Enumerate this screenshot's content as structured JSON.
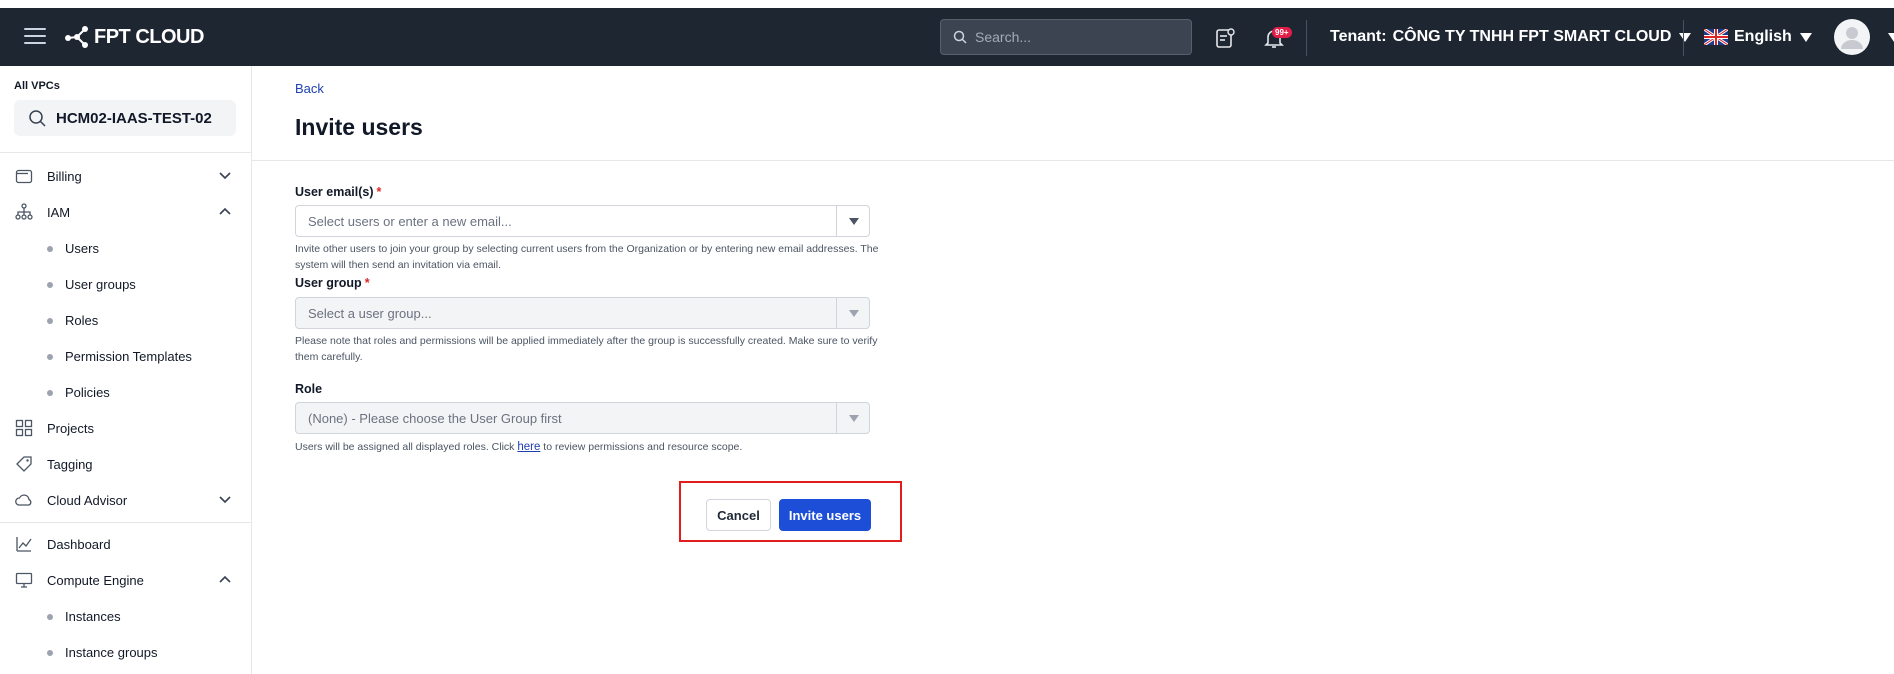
{
  "topbar": {
    "logo_text": "FPT CLOUD",
    "search_placeholder": "Search...",
    "notification_badge": "99+",
    "tenant_label": "Tenant:",
    "tenant_name": "CÔNG TY TNHH FPT SMART CLOUD",
    "language": "English",
    "language_flag": "uk-flag-icon"
  },
  "sidebar": {
    "vpc_label": "All VPCs",
    "vpc_value": "HCM02-IAAS-TEST-02",
    "items": [
      {
        "label": "Billing",
        "icon": "wallet-icon",
        "expanded": false
      },
      {
        "label": "IAM",
        "icon": "hierarchy-icon",
        "expanded": true
      },
      {
        "label": "Users"
      },
      {
        "label": "User groups"
      },
      {
        "label": "Roles"
      },
      {
        "label": "Permission Templates"
      },
      {
        "label": "Policies"
      },
      {
        "label": "Projects",
        "icon": "grid-icon"
      },
      {
        "label": "Tagging",
        "icon": "tag-icon"
      },
      {
        "label": "Cloud Advisor",
        "icon": "cloud-icon",
        "expanded": false
      },
      {
        "label": "Dashboard",
        "icon": "chart-icon"
      },
      {
        "label": "Compute Engine",
        "icon": "monitor-icon",
        "expanded": true
      },
      {
        "label": "Instances"
      },
      {
        "label": "Instance groups"
      }
    ]
  },
  "main": {
    "back_label": "Back",
    "title": "Invite users",
    "email_label": "User email(s)",
    "email_placeholder": "Select users or enter a new email...",
    "email_help": "Invite other users to join your group by selecting current users from the Organization or by entering new email addresses. The system will then send an invitation via email.",
    "group_label": "User group",
    "group_placeholder": "Select a user group...",
    "group_help": "Please note that roles and permissions will be applied immediately after the group is successfully created. Make sure to verify them carefully.",
    "role_label": "Role",
    "role_placeholder": "(None) - Please choose the User Group first",
    "role_help_before": "Users will be assigned all displayed roles. Click ",
    "role_help_link": "here",
    "role_help_after": " to review permissions and resource scope.",
    "required_mark": "*",
    "cancel_label": "Cancel",
    "invite_label": "Invite users"
  },
  "colors": {
    "topbar_bg": "#1e2632",
    "primary": "#1d4ed8",
    "highlight": "#e11d1d",
    "required": "#dc2626"
  }
}
